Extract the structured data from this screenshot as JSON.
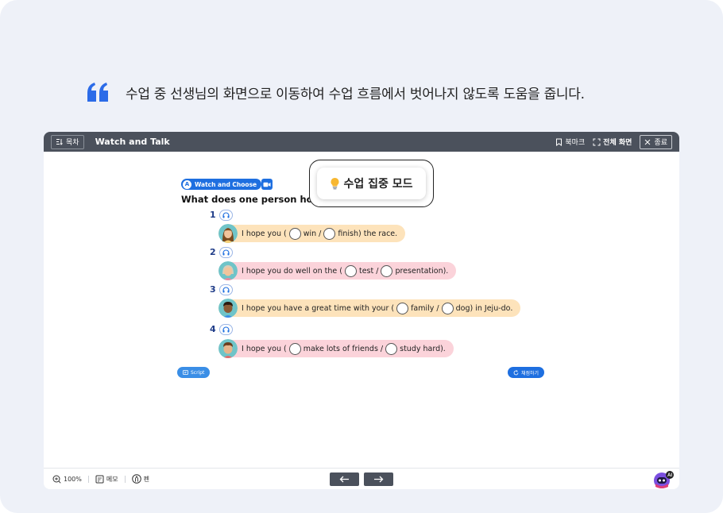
{
  "caption": {
    "text": "수업 중 선생님의 화면으로 이동하여 수업 흐름에서 벗어나지 않도록 도움을 줍니다.",
    "quote_color": "#2b6be8"
  },
  "topbar": {
    "toc_label": "목차",
    "title": "Watch and Talk",
    "bookmark_label": "북마크",
    "fullscreen_label": "전체 화면",
    "close_label": "종료"
  },
  "lesson": {
    "section_letter": "A",
    "section_label": "Watch and Choose",
    "question": "What does one person hope f",
    "items": [
      {
        "number": "1",
        "color": "orange",
        "avatar": "girl-avatar",
        "parts": [
          "I hope you (",
          "win /",
          "finish) the race."
        ]
      },
      {
        "number": "2",
        "color": "pink",
        "avatar": "grandma-avatar",
        "parts": [
          "I hope you do well on the (",
          "test /",
          "presentation)."
        ]
      },
      {
        "number": "3",
        "color": "orange",
        "avatar": "boy-avatar",
        "parts": [
          "I hope you have a great time with your (",
          "family /",
          "dog) in Jeju-do."
        ]
      },
      {
        "number": "4",
        "color": "pink",
        "avatar": "man-avatar",
        "parts": [
          "I hope you (",
          "make lots of friends /",
          "study hard)."
        ]
      }
    ],
    "script_label": "Script",
    "grade_label": "채점하기"
  },
  "focus_mode": {
    "label": "수업 집중 모드"
  },
  "bottombar": {
    "zoom": "100%",
    "memo_label": "메모",
    "pen_label": "펜",
    "ai_badge": "AI"
  },
  "colors": {
    "accent": "#1e6fe0",
    "topbar": "#4b515c",
    "bubble_orange": "#fde3bb",
    "bubble_pink": "#fbd3da"
  }
}
